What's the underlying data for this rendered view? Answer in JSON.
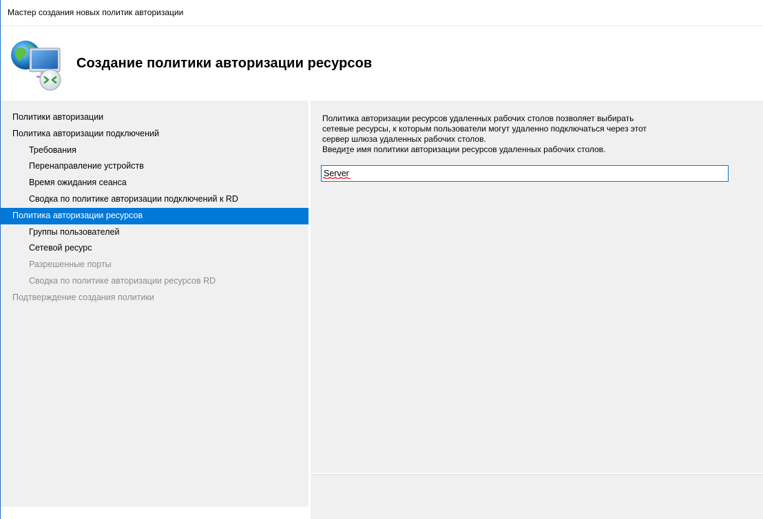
{
  "window": {
    "title": "Мастер создания новых политик авторизации"
  },
  "header": {
    "heading": "Создание политики авторизации ресурсов",
    "icon": "remote-desktop-gateway-icon"
  },
  "nav": {
    "items": [
      {
        "label": "Политики авторизации",
        "level": 0,
        "state": "normal"
      },
      {
        "label": "Политика авторизации подключений",
        "level": 0,
        "state": "normal"
      },
      {
        "label": "Требования",
        "level": 1,
        "state": "normal"
      },
      {
        "label": "Перенаправление устройств",
        "level": 1,
        "state": "normal"
      },
      {
        "label": "Время ожидания сеанса",
        "level": 1,
        "state": "normal"
      },
      {
        "label": "Сводка по политике авторизации подключений к RD",
        "level": 1,
        "state": "normal"
      },
      {
        "label": "Политика авторизации ресурсов",
        "level": 0,
        "state": "selected"
      },
      {
        "label": "Группы пользователей",
        "level": 1,
        "state": "normal"
      },
      {
        "label": "Сетевой ресурс",
        "level": 1,
        "state": "normal"
      },
      {
        "label": "Разрешенные порты",
        "level": 1,
        "state": "disabled"
      },
      {
        "label": "Сводка по политике авторизации ресурсов RD",
        "level": 1,
        "state": "disabled"
      },
      {
        "label": "Подтверждение создания политики",
        "level": 0,
        "state": "disabled"
      }
    ]
  },
  "content": {
    "description_lines": [
      "Политика авторизации ресурсов удаленных рабочих столов позволяет выбирать",
      "сетевые ресурсы, к которым пользователи могут удаленно подключаться через этот",
      "сервер шлюза удаленных рабочих столов."
    ],
    "prompt_before": "Введи",
    "prompt_access_key": "т",
    "prompt_after": "е имя политики авторизации ресурсов удаленных рабочих столов.",
    "policy_name_value": "Server"
  },
  "colors": {
    "selection": "#0078d7",
    "panel_background": "#f0f0f0",
    "disabled_text": "#8c8c8c",
    "spellcheck_underline": "#e81123"
  }
}
